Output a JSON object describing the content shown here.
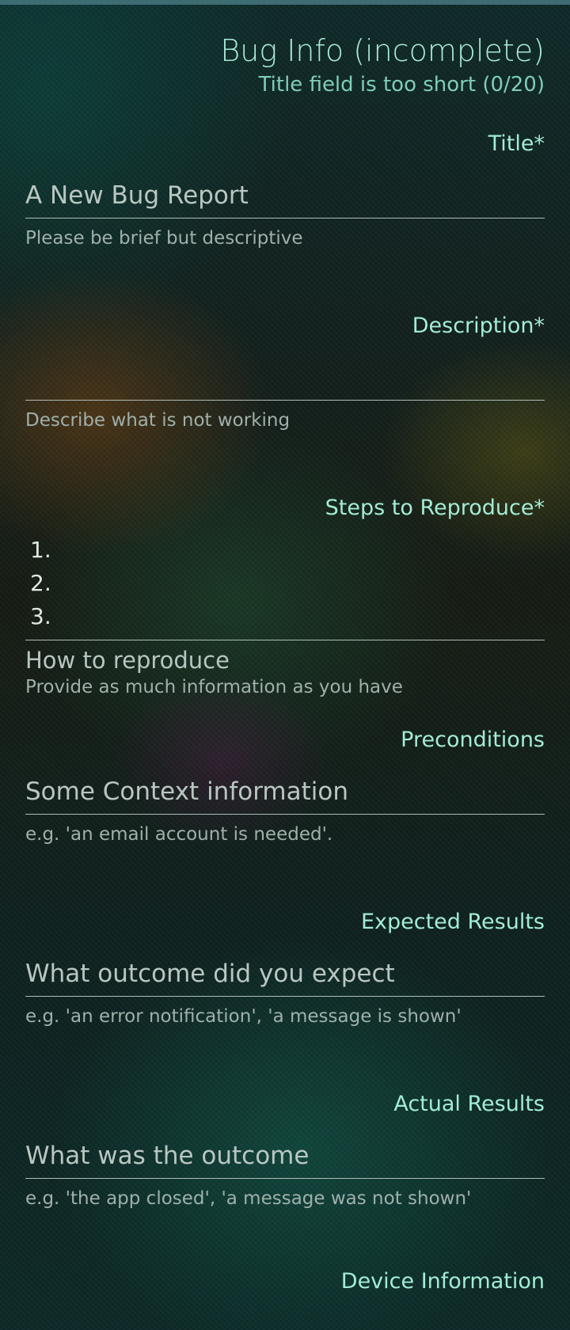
{
  "header": {
    "title": "Bug Info (incomplete)",
    "subtitle": "Title field is too short (0/20)"
  },
  "fields": {
    "title": {
      "label": "Title*",
      "placeholder": "A New Bug Report",
      "hint": "Please be brief but descriptive"
    },
    "description": {
      "label": "Description*",
      "value": "",
      "hint": "Describe what is not working"
    },
    "steps": {
      "label": "Steps to Reproduce*",
      "lines": [
        "1.",
        "2.",
        "3."
      ],
      "hint_title": "How to reproduce",
      "hint": "Provide as much information as you have"
    },
    "preconditions": {
      "label": "Preconditions",
      "placeholder": "Some Context information",
      "hint": "e.g. 'an email account is needed'."
    },
    "expected": {
      "label": "Expected Results",
      "placeholder": "What outcome did you expect",
      "hint": "e.g. 'an error notification', 'a message is shown'"
    },
    "actual": {
      "label": "Actual Results",
      "placeholder": "What was the outcome",
      "hint": "e.g. 'the app closed', 'a message was not shown'"
    },
    "device": {
      "label": "Device Information"
    }
  }
}
